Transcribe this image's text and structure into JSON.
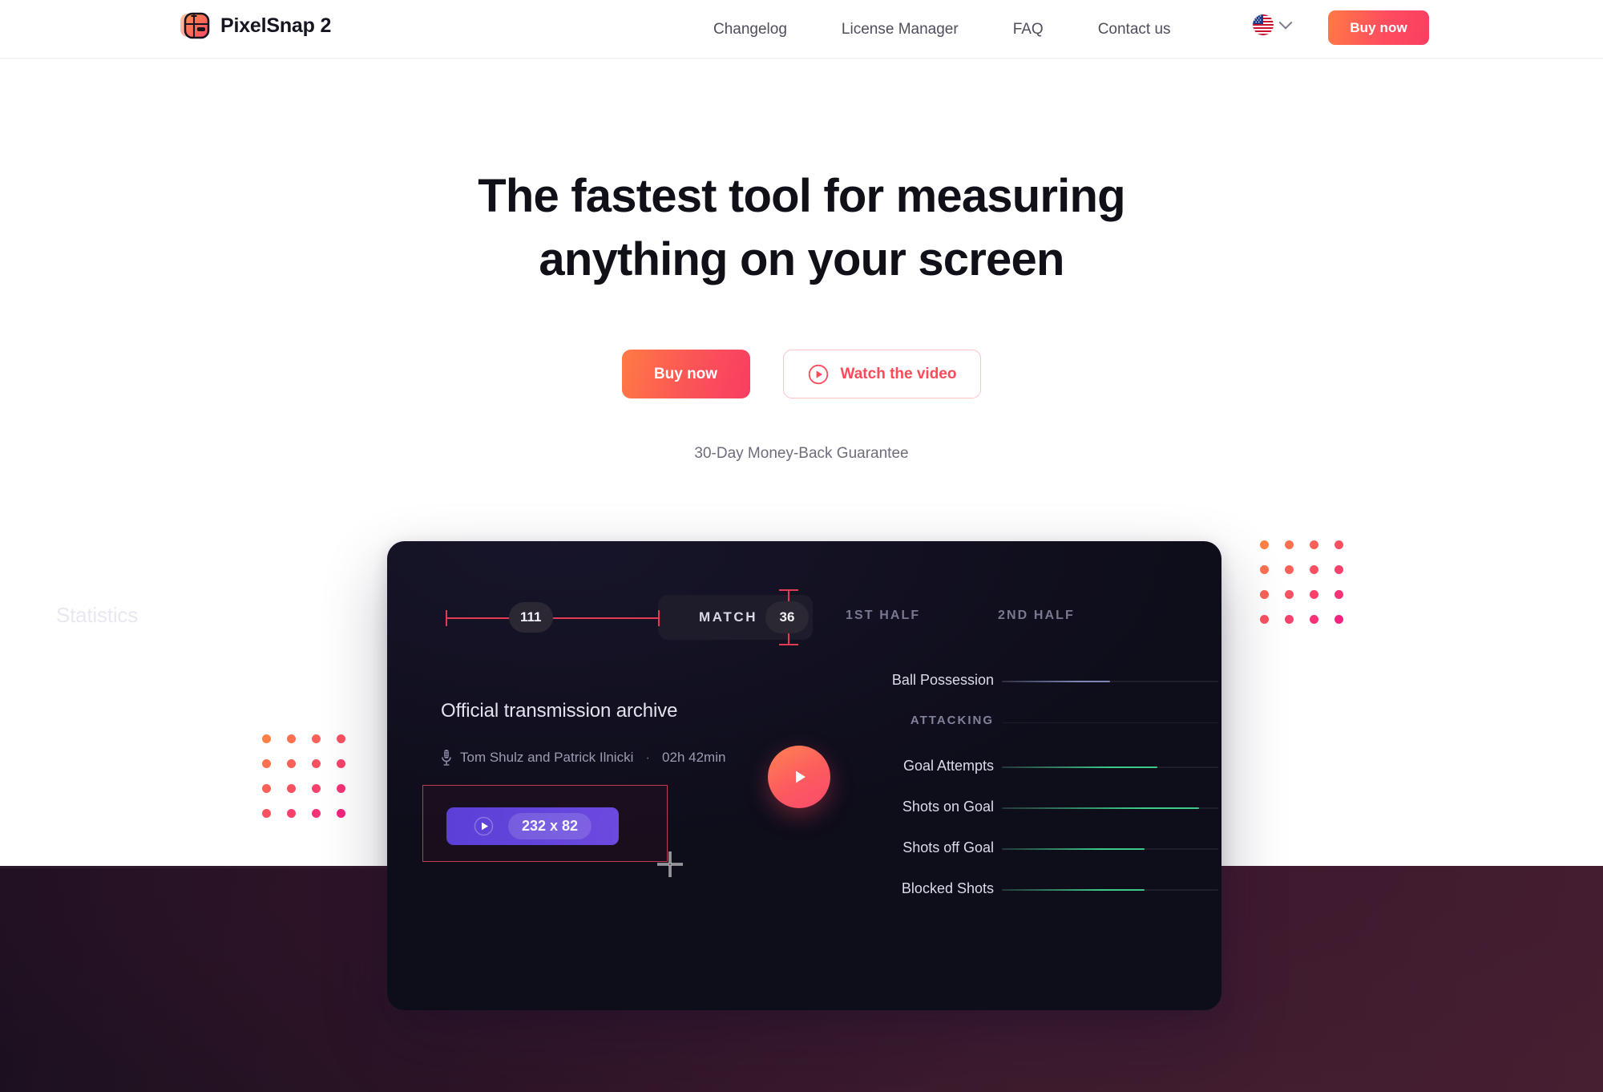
{
  "navbar": {
    "brand": "PixelSnap 2",
    "logo_icon": "pixelsnap-app-icon",
    "links": [
      {
        "label": "Changelog"
      },
      {
        "label": "License Manager"
      },
      {
        "label": "FAQ"
      },
      {
        "label": "Contact us"
      }
    ],
    "language": {
      "flag": "us-flag-icon",
      "chevron": "chevron-down-icon"
    },
    "buy_label": "Buy now"
  },
  "hero": {
    "title_line1": "The fastest tool for measuring",
    "title_line2": "anything on your screen",
    "buy_label": "Buy now",
    "watch_label": "Watch the video",
    "watch_icon": "play-circle-icon",
    "guarantee": "30-Day Money-Back Guarantee"
  },
  "decor": {
    "dot_grid_columns": 4,
    "dot_grid_rows": 4,
    "dot_color_start": "#ff7f45",
    "dot_color_end": "#f5237f"
  },
  "app": {
    "screen_title": "Statistics",
    "measurement_horizontal": "111",
    "measurement_vertical": "36",
    "match_label": "MATCH",
    "tabs": [
      {
        "label": "1ST HALF"
      },
      {
        "label": "2ND HALF"
      }
    ],
    "archive": {
      "title": "Official transmission archive",
      "mic_icon": "microphone-icon",
      "authors": "Tom Shulz and Patrick Ilnicki",
      "separator": "·",
      "duration": "02h 42min"
    },
    "selection": {
      "dimension_label": "232 x 82",
      "play_icon": "play-icon",
      "cursor_icon": "crosshair-cursor-icon",
      "selection_color": "#c23a52"
    },
    "big_play_icon": "play-button-icon",
    "section_label": "ATTACKING",
    "stats": [
      {
        "label": "Ball Possession",
        "fill": 0.5,
        "color": "#7d86b5"
      },
      {
        "label": "Goal Attempts",
        "fill": 0.72,
        "color": "#3ec98a"
      },
      {
        "label": "Shots on Goal",
        "fill": 0.91,
        "color": "#3ec98a"
      },
      {
        "label": "Shots off Goal",
        "fill": 0.66,
        "color": "#3ec98a"
      },
      {
        "label": "Blocked Shots",
        "fill": 0.66,
        "color": "#3ec98a"
      }
    ]
  }
}
